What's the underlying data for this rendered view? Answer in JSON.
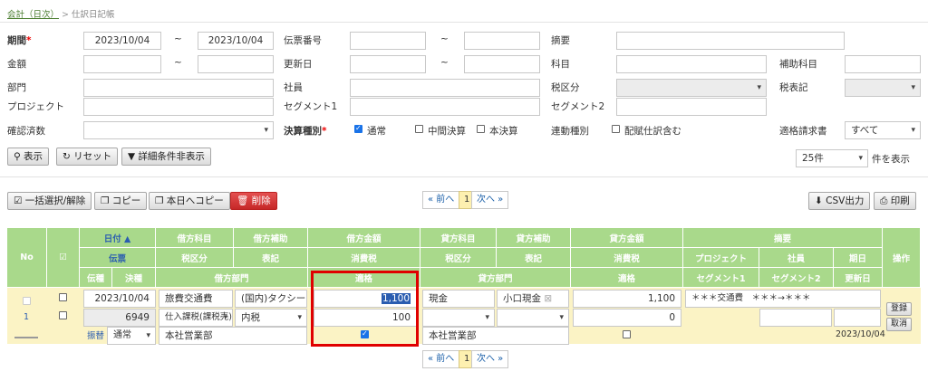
{
  "breadcrumb": {
    "parent": "会計（日次）",
    "sep": ">",
    "current": "仕訳日記帳"
  },
  "filters": {
    "period_label": "期間",
    "required_mark": "*",
    "period_from": "2023/10/04",
    "tilde": "~",
    "period_to": "2023/10/04",
    "slip_no_label": "伝票番号",
    "summary_label": "摘要",
    "amount_label": "金額",
    "updated_label": "更新日",
    "account_label": "科目",
    "sub_account_label": "補助科目",
    "dept_label": "部門",
    "employee_label": "社員",
    "tax_class_label": "税区分",
    "tax_display_label": "税表記",
    "project_label": "プロジェクト",
    "segment1_label": "セグメント1",
    "segment2_label": "セグメント2",
    "confirmed_label": "確認済数",
    "closing_type_label": "決算種別",
    "closing_normal": "通常",
    "closing_interim": "中間決算",
    "closing_final": "本決算",
    "linked_type_label": "連動種別",
    "include_allocation": "配賦仕訳含む",
    "invoice_label": "適格請求書",
    "invoice_value": "すべて"
  },
  "actions": {
    "show": "表示",
    "reset": "リセット",
    "toggle_detail": "詳細条件非表示",
    "per_page_value": "25件",
    "per_page_suffix": "件を表示",
    "bulk_select": "一括選択/解除",
    "copy": "コピー",
    "copy_today": "本日へコピー",
    "delete": "削除",
    "csv": "CSV出力",
    "print": "印刷"
  },
  "pager": {
    "prev": "« 前へ",
    "page": "1",
    "next": "次へ »"
  },
  "table": {
    "h_no": "No",
    "h_check": "☑",
    "h_date": "日付 ▲",
    "h_slip": "伝票",
    "h_slip_type": "伝種",
    "h_settle": "決種",
    "h_dr_account": "借方科目",
    "h_dr_sub": "借方補助",
    "h_dr_tax_class": "税区分",
    "h_dr_tax_disp": "表記",
    "h_dr_dept": "借方部門",
    "h_dr_amount": "借方金額",
    "h_dr_tax": "消費税",
    "h_dr_qualified": "適格",
    "h_cr_account": "貸方科目",
    "h_cr_sub": "貸方補助",
    "h_cr_tax_class": "税区分",
    "h_cr_tax_disp": "表記",
    "h_cr_dept": "貸方部門",
    "h_cr_amount": "貸方金額",
    "h_cr_tax": "消費税",
    "h_cr_qualified": "適格",
    "h_summary": "摘要",
    "h_project": "プロジェクト",
    "h_employee": "社員",
    "h_due": "期日",
    "h_seg1": "セグメント1",
    "h_seg2": "セグメント2",
    "h_updated": "更新日",
    "h_ops": "操作",
    "row": {
      "no": "1",
      "date": "2023/10/04",
      "slip_no": "6949",
      "transfer_label": "振替",
      "settle_type": "通常",
      "dr_account": "旅費交通費",
      "dr_sub": "(国内)タクシー",
      "dr_tax_class": "仕入課税(課税売)",
      "dr_tax_disp": "内税",
      "dr_dept": "本社営業部",
      "dr_amount": "1,100",
      "dr_tax": "100",
      "cr_account": "現金",
      "cr_sub": "小口現金",
      "cr_dept": "本社営業部",
      "cr_amount": "1,100",
      "cr_tax": "0",
      "summary": "＊＊＊交通費　＊＊＊→＊＊＊",
      "updated": "2023/10/04",
      "register": "登録",
      "cancel": "取消"
    }
  },
  "colors": {
    "header_green": "#a9d98b",
    "row_yellow": "#fbf3c5",
    "highlight_red": "#e00000",
    "delete_red": "#d33"
  }
}
